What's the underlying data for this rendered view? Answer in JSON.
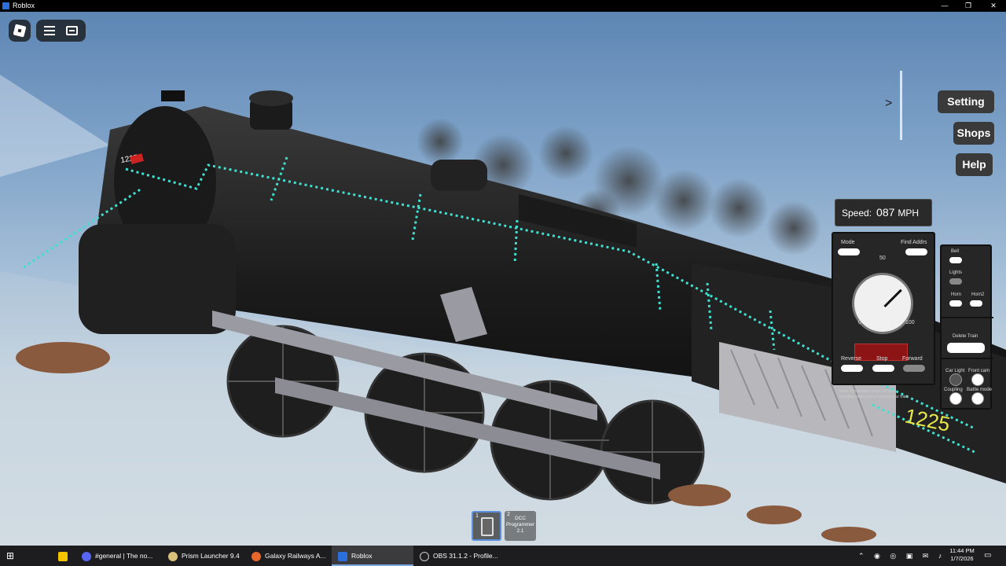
{
  "window": {
    "title": "Roblox",
    "minimize": "—",
    "maximize": "❐",
    "close": "✕"
  },
  "roblox_menu": {
    "logo_icon": "roblox-logo-icon",
    "menu_icon": "hamburger-icon",
    "chat_icon": "chat-icon"
  },
  "side_menu": {
    "toggle": ">",
    "setting": "Setting",
    "shops": "Shops",
    "help": "Help"
  },
  "speed": {
    "label": "Speed:",
    "value": "087",
    "unit": "MPH"
  },
  "controller": {
    "mode_label": "Mode",
    "find_addrs_label": "Find Addrs",
    "dial_top": "50",
    "dial_min": "0",
    "dial_max": "100",
    "reverse_label": "Reverse",
    "stop_label": "Stop",
    "forward_label": "Forward",
    "note": "Note: Remember to turn off your coupling when you're running your train."
  },
  "functions": {
    "bell_label": "Bell",
    "lights_label": "Lights",
    "horn_label": "Horn",
    "horn2_label": "Horn2",
    "delete_train_label": "Delete Train",
    "carlight_label": "Car Light",
    "frontcam_label": "Front cam",
    "coupling_label": "Coupling",
    "battlemode_label": "Battle mode"
  },
  "locomotive": {
    "number": "1225"
  },
  "hotbar": [
    {
      "slot": "1",
      "label": ""
    },
    {
      "slot": "2",
      "label": "DCC Programmer 2.1"
    }
  ],
  "taskbar": {
    "items": [
      {
        "label": "#general | The no..."
      },
      {
        "label": "Prism Launcher 9.4"
      },
      {
        "label": "Galaxy Railways A..."
      },
      {
        "label": "Roblox"
      },
      {
        "label": "OBS 31.1.2 - Profile..."
      }
    ],
    "time": "11:44 PM",
    "date": "1/7/2026"
  }
}
